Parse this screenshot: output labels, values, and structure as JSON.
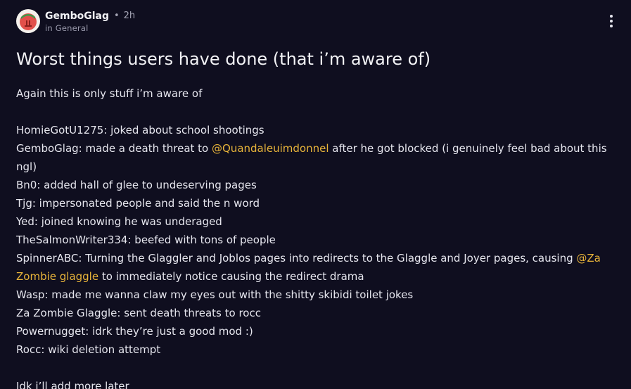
{
  "post": {
    "author": "GemboGlag",
    "separator": "•",
    "time": "2h",
    "community": "in General",
    "avatar_icon": "strawberry-avatar-icon",
    "more_icon": "vertical-ellipsis-icon",
    "title": "Worst things users have done (that i’m aware of)",
    "intro": "Again this is only stuff i’m aware of",
    "lines": {
      "l1": "HomieGotU1275: joked about school shootings",
      "l2_pre": "GemboGlag: made a death threat to ",
      "l2_mention": "@Quandaleuimdonnel",
      "l2_post": " after he got blocked (i genuinely feel bad about this ngl)",
      "l3": "Bn0: added hall of glee to undeserving pages",
      "l4": "Tjg: impersonated people and said the n word",
      "l5": "Yed: joined knowing he was underaged",
      "l6": "TheSalmonWriter334: beefed with tons of people",
      "l7_pre": "SpinnerABC: Turning the Glaggler and Joblos pages into redirects to the Glaggle and Joyer pages, causing ",
      "l7_mention": "@Za Zombie glaggle",
      "l7_post": " to immediately notice causing the redirect drama",
      "l8": "Wasp: made me wanna claw my eyes out with the shitty skibidi toilet jokes",
      "l9": "Za Zombie Glaggle: sent death threats to rocc",
      "l10": "Powernugget: idrk they’re just a good mod :)",
      "l11": "Rocc: wiki deletion attempt"
    },
    "outro": "Idk i’ll add more later"
  },
  "colors": {
    "background": "#0f0e1f",
    "text": "#e6e6ee",
    "muted": "#a3a3b3",
    "mention": "#e8b43a"
  }
}
